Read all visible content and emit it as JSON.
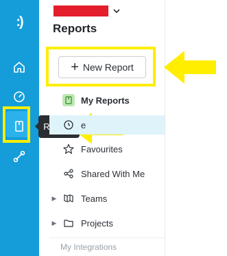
{
  "rail": {
    "logo": ":)",
    "accent_color": "#159dd9",
    "icons": [
      "home-icon",
      "dashboard-gauge-icon",
      "reports-icon",
      "integrations-icon"
    ]
  },
  "tooltip": {
    "text": "Reports"
  },
  "header": {
    "title": "Reports",
    "workspace_redacted_color": "#e31d2b"
  },
  "new_report": {
    "label": "New Report"
  },
  "nav": {
    "items": [
      {
        "label": "My Reports",
        "icon": "report-icon"
      },
      {
        "label": "Reports Shared With Me",
        "icon": "clock-icon",
        "partial_label": "e"
      },
      {
        "label": "Favourites",
        "icon": "star-icon"
      },
      {
        "label": "Shared With Me",
        "icon": "share-icon"
      },
      {
        "label": "Teams",
        "icon": "teams-icon"
      },
      {
        "label": "Projects",
        "icon": "folder-icon"
      }
    ]
  },
  "section": {
    "integrations_label": "My Integrations"
  },
  "highlight_color": "#ffee00"
}
